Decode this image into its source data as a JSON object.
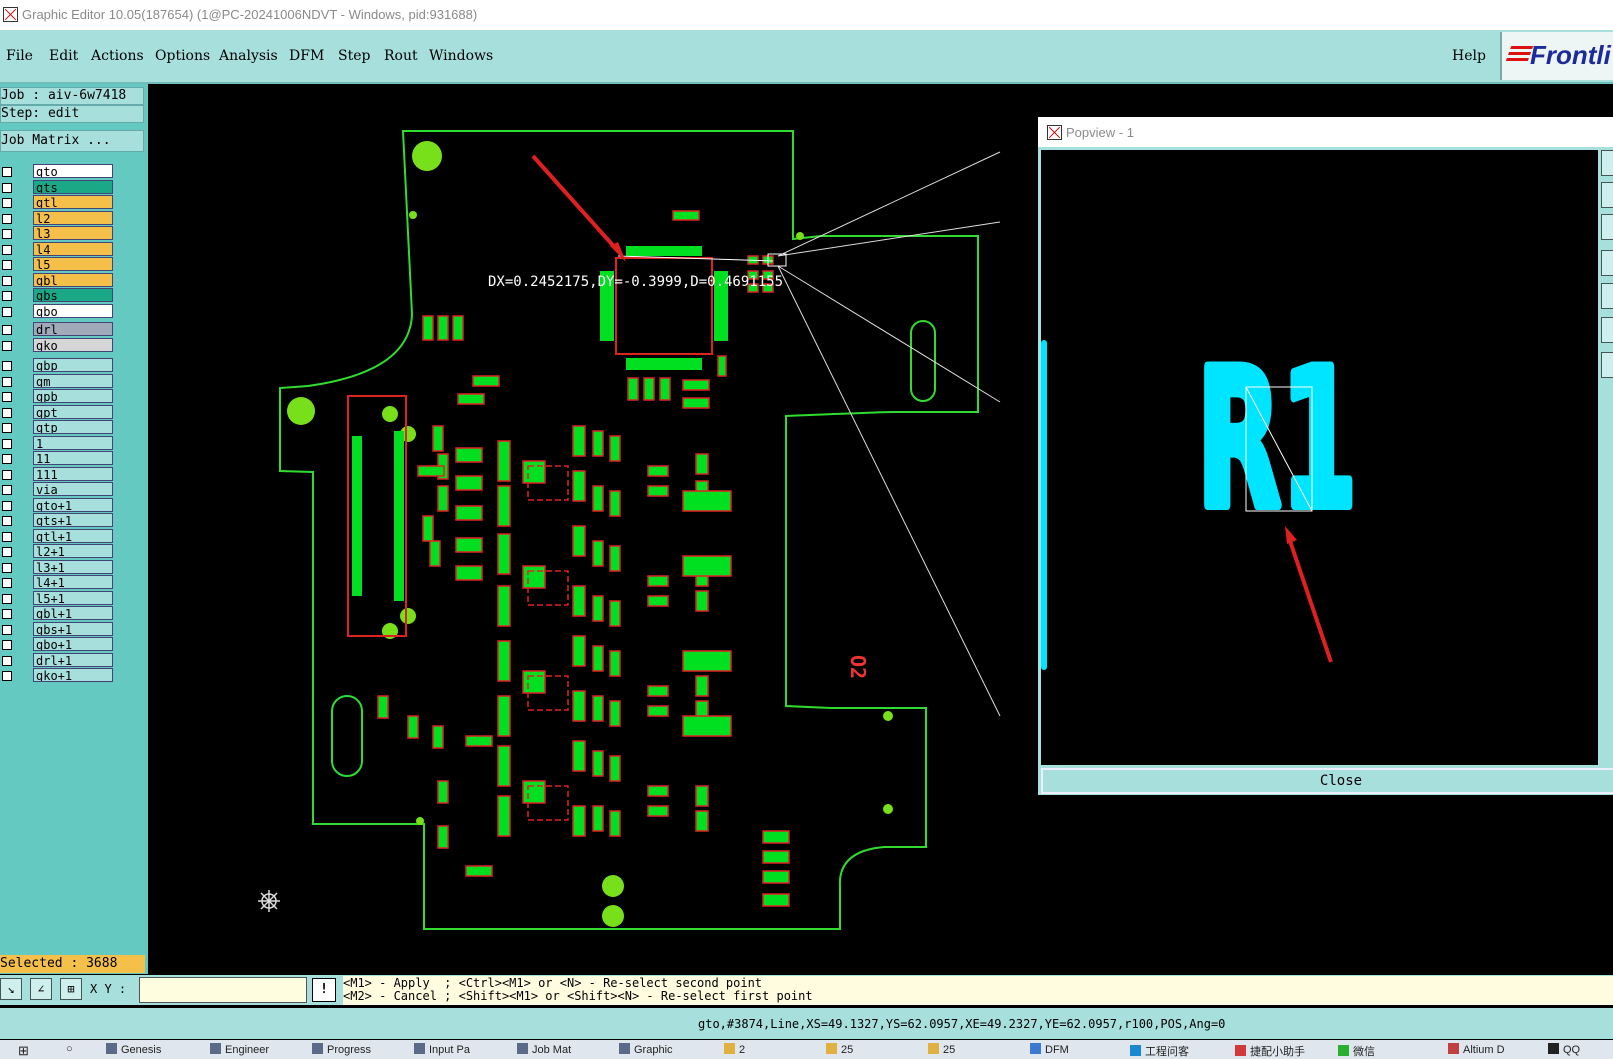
{
  "window": {
    "title": "Graphic Editor 10.05(187654) (1@PC-20241006NDVT - Windows, pid:931688)"
  },
  "menu": {
    "items": [
      "File",
      "Edit",
      "Actions",
      "Options",
      "Analysis",
      "DFM",
      "Step",
      "Rout",
      "Windows"
    ],
    "help": "Help",
    "brand": "Frontli"
  },
  "job": {
    "job_label": "Job : aiv-6w7418",
    "step_label": "Step: edit",
    "matrix_button": "Job Matrix ..."
  },
  "layers": {
    "group1": [
      {
        "name": "gto",
        "color": "#ffffff"
      },
      {
        "name": "gts",
        "color": "#1aa886"
      },
      {
        "name": "gtl",
        "color": "#f5c04a"
      },
      {
        "name": "l2",
        "color": "#f5c04a"
      },
      {
        "name": "l3",
        "color": "#f5c04a"
      },
      {
        "name": "l4",
        "color": "#f5c04a"
      },
      {
        "name": "l5",
        "color": "#f5c04a"
      },
      {
        "name": "gbl",
        "color": "#f5c04a"
      },
      {
        "name": "gbs",
        "color": "#1aa886"
      },
      {
        "name": "gbo",
        "color": "#ffffff"
      }
    ],
    "group2": [
      {
        "name": "drl",
        "color": "#a0aab8"
      },
      {
        "name": "gko",
        "color": "#d6d6d6"
      }
    ],
    "group3": [
      {
        "name": "gbp",
        "color": "#a6dfdc"
      },
      {
        "name": "gm",
        "color": "#a6dfdc"
      },
      {
        "name": "gpb",
        "color": "#a6dfdc"
      },
      {
        "name": "gpt",
        "color": "#a6dfdc"
      },
      {
        "name": "gtp",
        "color": "#a6dfdc"
      },
      {
        "name": "1",
        "color": "#a6dfdc"
      },
      {
        "name": "11",
        "color": "#a6dfdc"
      },
      {
        "name": "111",
        "color": "#a6dfdc"
      },
      {
        "name": "via",
        "color": "#a6dfdc"
      },
      {
        "name": "gto+1",
        "color": "#a6dfdc"
      },
      {
        "name": "gts+1",
        "color": "#a6dfdc"
      },
      {
        "name": "gtl+1",
        "color": "#a6dfdc"
      },
      {
        "name": "l2+1",
        "color": "#a6dfdc"
      },
      {
        "name": "l3+1",
        "color": "#a6dfdc"
      },
      {
        "name": "l4+1",
        "color": "#a6dfdc"
      },
      {
        "name": "l5+1",
        "color": "#a6dfdc"
      },
      {
        "name": "gbl+1",
        "color": "#a6dfdc"
      },
      {
        "name": "gbs+1",
        "color": "#a6dfdc"
      },
      {
        "name": "gbo+1",
        "color": "#a6dfdc"
      },
      {
        "name": "drl+1",
        "color": "#a6dfdc"
      },
      {
        "name": "gko+1",
        "color": "#a6dfdc"
      }
    ]
  },
  "selected": "Selected : 3688",
  "canvas": {
    "measure": "DX=0.2452175,DY=-0.3999,D=0.4691155",
    "o2_label": "O2"
  },
  "popview": {
    "title": "Popview - 1",
    "close": "Close",
    "zoom_label": "R1"
  },
  "bottom": {
    "xy_label": "X Y :",
    "xy_value": "",
    "hint_line1": "<M1> - Apply  ; <Ctrl><M1> or <N> - Re-select second point",
    "hint_line2": "<M2> - Cancel ; <Shift><M1> or <Shift><N> - Re-select first point"
  },
  "status": "gto,#3874,Line,XS=49.1327,YS=62.0957,XE=49.2327,YE=62.0957,r100,POS,Ang=0",
  "taskbar": {
    "items": [
      "Genesis",
      "Engineer",
      "Progress",
      "Input Pa",
      "Job Mat",
      "Graphic",
      "2",
      "25",
      "25",
      "DFM",
      "工程问客",
      "捷配小助手",
      "微信",
      "Altium D",
      "QQ"
    ]
  },
  "colors": {
    "teal": "#a6dfdc",
    "board_outline": "#30dc30",
    "pad": "#00e020",
    "silk": "#dd2222",
    "cyan": "#00e5ff"
  }
}
